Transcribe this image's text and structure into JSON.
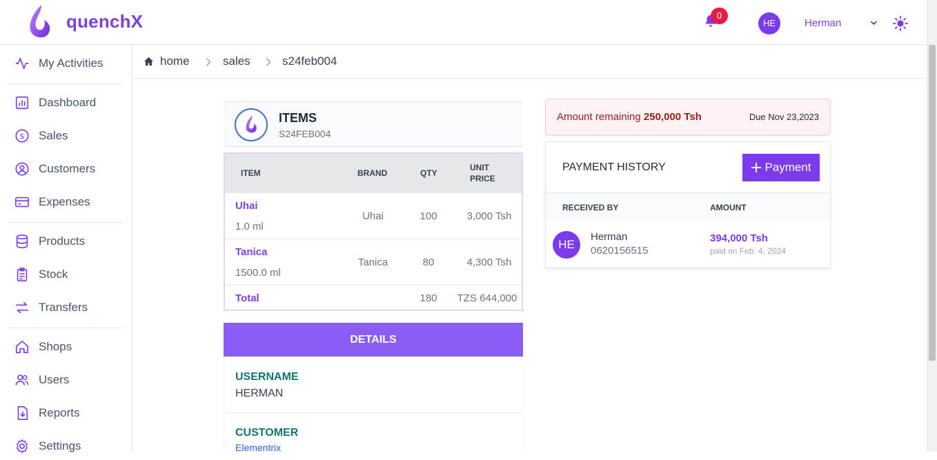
{
  "app": {
    "brand": "quenchX"
  },
  "header": {
    "notification_count": "0",
    "user_initials": "HE",
    "user_name": "Herman"
  },
  "sidebar": {
    "items": [
      {
        "label": "My Activities",
        "icon": "activity-icon"
      },
      {
        "label": "Dashboard",
        "icon": "chart-icon"
      },
      {
        "label": "Sales",
        "icon": "dollar-icon"
      },
      {
        "label": "Customers",
        "icon": "user-circle-icon"
      },
      {
        "label": "Expenses",
        "icon": "credit-card-icon"
      },
      {
        "label": "Products",
        "icon": "database-icon"
      },
      {
        "label": "Stock",
        "icon": "clipboard-icon"
      },
      {
        "label": "Transfers",
        "icon": "transfer-icon"
      },
      {
        "label": "Shops",
        "icon": "home-icon"
      },
      {
        "label": "Users",
        "icon": "users-icon"
      },
      {
        "label": "Reports",
        "icon": "report-icon"
      },
      {
        "label": "Settings",
        "icon": "gear-icon"
      }
    ]
  },
  "breadcrumb": {
    "home": "home",
    "section": "sales",
    "current": "s24feb004"
  },
  "items_card": {
    "title": "ITEMS",
    "code": "S24FEB004",
    "columns": {
      "item": "ITEM",
      "brand": "BRAND",
      "qty": "QTY",
      "unit_price_1": "UNIT",
      "unit_price_2": "PRICE"
    },
    "rows": [
      {
        "name": "Uhai",
        "size": "1.0 ml",
        "brand": "Uhai",
        "qty": "100",
        "price": "3,000 Tsh"
      },
      {
        "name": "Tanica",
        "size": "1500.0 ml",
        "brand": "Tanica",
        "qty": "80",
        "price": "4,300 Tsh"
      }
    ],
    "total": {
      "label": "Total",
      "qty": "180",
      "amount": "TZS 644,000"
    }
  },
  "details": {
    "title": "DETAILS",
    "username_label": "USERNAME",
    "username": "HERMAN",
    "customer_label": "CUSTOMER",
    "customer": "Elementrix"
  },
  "remaining": {
    "prefix": "Amount remaining",
    "amount": "250,000 Tsh",
    "due": "Due Nov 23,2023"
  },
  "payment_history": {
    "title": "PAYMENT HISTORY",
    "add_button": "Payment",
    "columns": {
      "received_by": "RECEIVED BY",
      "amount": "AMOUNT"
    },
    "entries": [
      {
        "initials": "HE",
        "name": "Herman",
        "phone": "0620156515",
        "amount": "394,000 Tsh",
        "date": "paid on Feb. 4, 2024"
      }
    ]
  },
  "colors": {
    "brand": "#7c3aed",
    "details_bar": "#8b5cf6",
    "badge": "#e11d48",
    "label_teal": "#0f766e"
  }
}
